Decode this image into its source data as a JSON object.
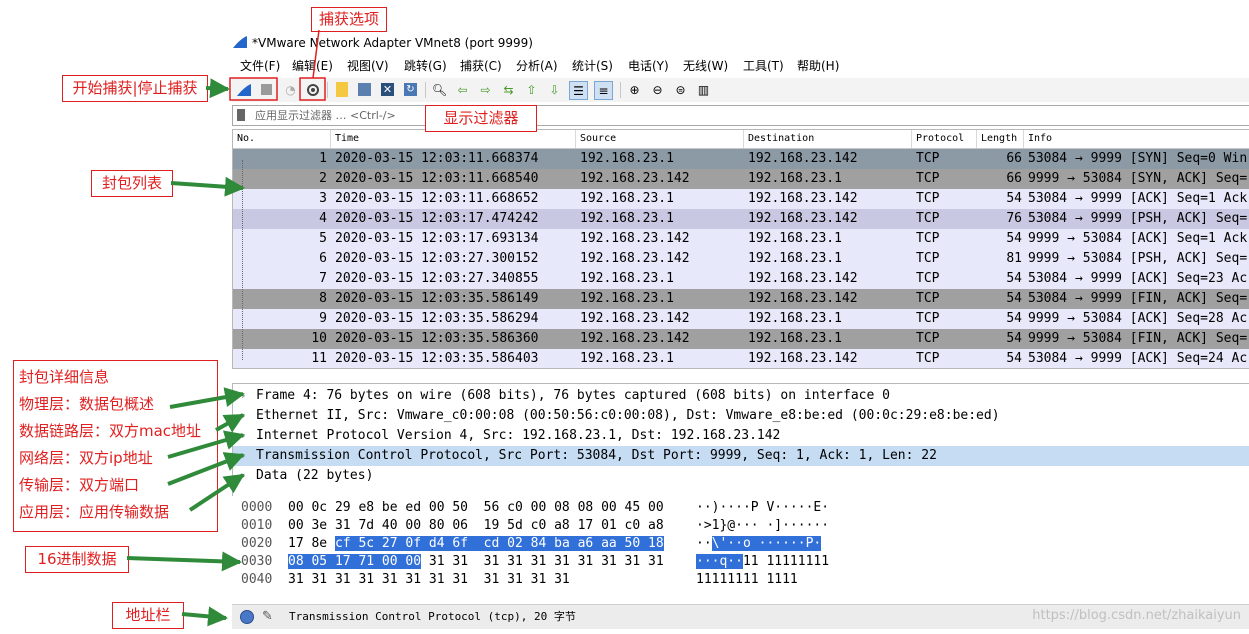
{
  "window": {
    "title": "*VMware Network Adapter VMnet8 (port 9999)"
  },
  "menu": [
    "文件(F)",
    "编辑(E)",
    "视图(V)",
    "跳转(G)",
    "捕获(C)",
    "分析(A)",
    "统计(S)",
    "电话(Y)",
    "无线(W)",
    "工具(T)",
    "帮助(H)"
  ],
  "filter": {
    "placeholder": "应用显示过滤器 … <Ctrl-/>"
  },
  "packet_list": {
    "columns": [
      "No.",
      "Time",
      "Source",
      "Destination",
      "Protocol",
      "Length",
      "Info"
    ],
    "rows": [
      {
        "no": "1",
        "time": "2020-03-15 12:03:11.668374",
        "src": "192.168.23.1",
        "dst": "192.168.23.142",
        "proto": "TCP",
        "len": "66",
        "info": "53084 → 9999 [SYN] Seq=0 Win",
        "bg": "#8c9aa6"
      },
      {
        "no": "2",
        "time": "2020-03-15 12:03:11.668540",
        "src": "192.168.23.142",
        "dst": "192.168.23.1",
        "proto": "TCP",
        "len": "66",
        "info": "9999 → 53084 [SYN, ACK] Seq=",
        "bg": "#a0a0a0"
      },
      {
        "no": "3",
        "time": "2020-03-15 12:03:11.668652",
        "src": "192.168.23.1",
        "dst": "192.168.23.142",
        "proto": "TCP",
        "len": "54",
        "info": "53084 → 9999 [ACK] Seq=1 Ack",
        "bg": "#e8e8fb"
      },
      {
        "no": "4",
        "time": "2020-03-15 12:03:17.474242",
        "src": "192.168.23.1",
        "dst": "192.168.23.142",
        "proto": "TCP",
        "len": "76",
        "info": "53084 → 9999 [PSH, ACK] Seq=",
        "bg": "#c8c8e2"
      },
      {
        "no": "5",
        "time": "2020-03-15 12:03:17.693134",
        "src": "192.168.23.142",
        "dst": "192.168.23.1",
        "proto": "TCP",
        "len": "54",
        "info": "9999 → 53084 [ACK] Seq=1 Ack",
        "bg": "#e8e8fb"
      },
      {
        "no": "6",
        "time": "2020-03-15 12:03:27.300152",
        "src": "192.168.23.142",
        "dst": "192.168.23.1",
        "proto": "TCP",
        "len": "81",
        "info": "9999 → 53084 [PSH, ACK] Seq=",
        "bg": "#e8e8fb"
      },
      {
        "no": "7",
        "time": "2020-03-15 12:03:27.340855",
        "src": "192.168.23.1",
        "dst": "192.168.23.142",
        "proto": "TCP",
        "len": "54",
        "info": "53084 → 9999 [ACK] Seq=23 Ac",
        "bg": "#e8e8fb"
      },
      {
        "no": "8",
        "time": "2020-03-15 12:03:35.586149",
        "src": "192.168.23.1",
        "dst": "192.168.23.142",
        "proto": "TCP",
        "len": "54",
        "info": "53084 → 9999 [FIN, ACK] Seq=",
        "bg": "#a0a0a0"
      },
      {
        "no": "9",
        "time": "2020-03-15 12:03:35.586294",
        "src": "192.168.23.142",
        "dst": "192.168.23.1",
        "proto": "TCP",
        "len": "54",
        "info": "9999 → 53084 [ACK] Seq=28 Ac",
        "bg": "#e8e8fb"
      },
      {
        "no": "10",
        "time": "2020-03-15 12:03:35.586360",
        "src": "192.168.23.142",
        "dst": "192.168.23.1",
        "proto": "TCP",
        "len": "54",
        "info": "9999 → 53084 [FIN, ACK] Seq=",
        "bg": "#a0a0a0"
      },
      {
        "no": "11",
        "time": "2020-03-15 12:03:35.586403",
        "src": "192.168.23.1",
        "dst": "192.168.23.142",
        "proto": "TCP",
        "len": "54",
        "info": "53084 → 9999 [ACK] Seq=24 Ac",
        "bg": "#e8e8fb"
      }
    ]
  },
  "details": [
    {
      "text": "Frame 4: 76 bytes on wire (608 bits), 76 bytes captured (608 bits) on interface 0",
      "selected": false
    },
    {
      "text": "Ethernet II, Src: Vmware_c0:00:08 (00:50:56:c0:00:08), Dst: Vmware_e8:be:ed (00:0c:29:e8:be:ed)",
      "selected": false
    },
    {
      "text": "Internet Protocol Version 4, Src: 192.168.23.1, Dst: 192.168.23.142",
      "selected": false
    },
    {
      "text": "Transmission Control Protocol, Src Port: 53084, Dst Port: 9999, Seq: 1, Ack: 1, Len: 22",
      "selected": true
    },
    {
      "text": "Data (22 bytes)",
      "selected": false
    }
  ],
  "hex": [
    {
      "offset": "0000",
      "pre": "00 0c 29 e8 be ed 00 50  56 c0 00 08 08 00 45 00",
      "sel": "",
      "post": "",
      "apre": "··)····P V·····E·",
      "asel": "",
      "apost": ""
    },
    {
      "offset": "0010",
      "pre": "00 3e 31 7d 40 00 80 06  19 5d c0 a8 17 01 c0 a8",
      "sel": "",
      "post": "",
      "apre": "·>1}@··· ·]······",
      "asel": "",
      "apost": ""
    },
    {
      "offset": "0020",
      "pre": "17 8e ",
      "sel": "cf 5c 27 0f d4 6f  cd 02 84 ba a6 aa 50 18",
      "post": "",
      "apre": "··",
      "asel": "\\'··o ······P·",
      "apost": ""
    },
    {
      "offset": "0030",
      "pre": "",
      "sel": "08 05 17 71 00 00",
      "post": " 31 31  31 31 31 31 31 31 31 31",
      "apre": "",
      "asel": "···q··",
      "apost": "11 11111111"
    },
    {
      "offset": "0040",
      "pre": "31 31 31 31 31 31 31 31  31 31 31 31",
      "sel": "",
      "post": "",
      "apre": "11111111 1111",
      "asel": "",
      "apost": ""
    }
  ],
  "status": {
    "text": "Transmission Control Protocol (tcp), 20 字节"
  },
  "annotations": {
    "capture_options": "捕获选项",
    "start_stop": "开始捕获|停止捕获",
    "display_filter": "显示过滤器",
    "packet_list": "封包列表",
    "details_title": "封包详细信息",
    "physical": "物理层：数据包概述",
    "datalink": "数据链路层：双方mac地址",
    "network": "网络层：双方ip地址",
    "transport": "传输层：双方端口",
    "application": "应用层：应用传输数据",
    "hex": "16进制数据",
    "address_bar": "地址栏"
  },
  "watermark": "https://blog.csdn.net/zhaikaiyun",
  "colors": {
    "annotation": "#e02020",
    "arrow": "#2f8a3a",
    "selection": "#3070d8",
    "detail_selected": "#c5dcf3",
    "shark_fin": "#2266cc"
  }
}
